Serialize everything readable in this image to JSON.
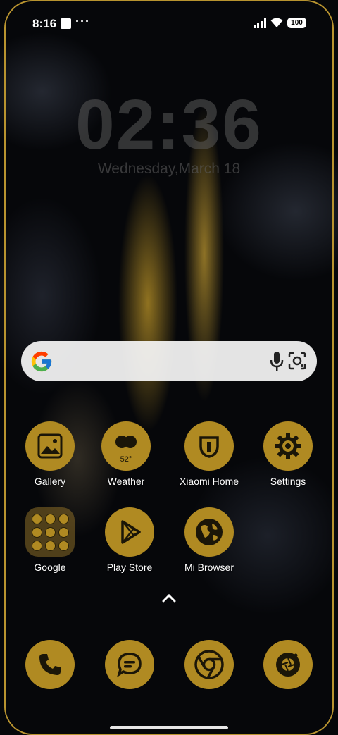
{
  "status_bar": {
    "time": "8:16",
    "notification_dots": "···",
    "battery": "100"
  },
  "clock_widget": {
    "time": "02:36",
    "date": "Wednesday,March 18"
  },
  "search_bar": {
    "icons": [
      "google-logo",
      "microphone-icon",
      "lens-camera-icon"
    ]
  },
  "apps": [
    {
      "label": "Gallery",
      "icon": "image-icon"
    },
    {
      "label": "Weather",
      "icon": "weather-cloud-icon",
      "temp": "52°"
    },
    {
      "label": "Xiaomi Home",
      "icon": "xiaomi-home-icon"
    },
    {
      "label": "Settings",
      "icon": "gear-icon"
    },
    {
      "label": "Google",
      "icon": "folder-icon"
    },
    {
      "label": "Play Store",
      "icon": "play-store-icon"
    },
    {
      "label": "Mi Browser",
      "icon": "globe-icon"
    }
  ],
  "dock": [
    {
      "icon": "phone-icon"
    },
    {
      "icon": "messages-icon"
    },
    {
      "icon": "chrome-icon"
    },
    {
      "icon": "camera-icon"
    }
  ],
  "colors": {
    "accent_gold": "#b08a22",
    "icon_glyph": "#1b1608",
    "frame": "#b8932f"
  }
}
